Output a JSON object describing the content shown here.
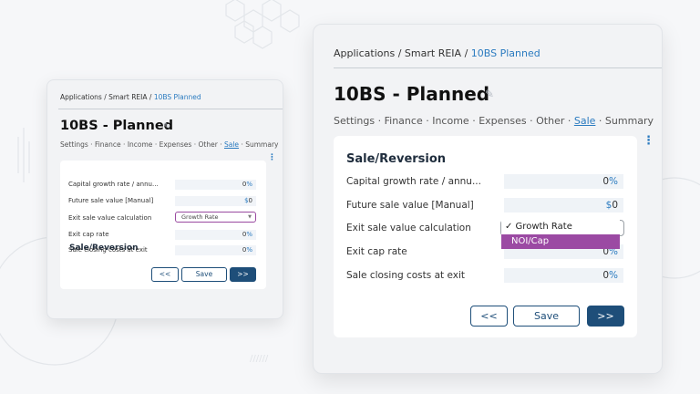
{
  "breadcrumb": {
    "part1": "Applications",
    "sep": "/",
    "part2": "Smart REIA",
    "current": "10BS Planned"
  },
  "page": {
    "title": "10BS - Planned"
  },
  "tabs": [
    "Settings",
    "Finance",
    "Income",
    "Expenses",
    "Other",
    "Sale",
    "Summary"
  ],
  "tab_separator": "·",
  "active_tab": "Sale",
  "section": {
    "title": "Sale/Reversion",
    "small_rows": [
      {
        "label": "Capital growth rate / annu...",
        "value": "0",
        "unit": "%"
      },
      {
        "label": "Future sale value [Manual]",
        "value": "0",
        "unit": "$"
      },
      {
        "label": "Exit sale value calculation",
        "select": "Growth Rate"
      },
      {
        "label": "Exit cap rate",
        "value": "0",
        "unit": "%"
      },
      {
        "label": "Sale closing costs at exit",
        "value": "0",
        "unit": "%"
      }
    ],
    "large_rows": [
      {
        "label": "Capital growth rate / annu...",
        "value": "0",
        "unit": "%"
      },
      {
        "label": "Future sale value [Manual]",
        "value": "0",
        "unit": "$"
      },
      {
        "label": "Exit sale value calculation"
      },
      {
        "label": "Exit cap rate",
        "value": "0",
        "unit": "%"
      },
      {
        "label": "Sale closing costs at exit",
        "value": "0",
        "unit": "%"
      }
    ]
  },
  "dropdown": {
    "options": [
      "✓ Growth Rate",
      "NOI/Cap"
    ],
    "highlighted": "NOI/Cap"
  },
  "buttons": {
    "prev": "<<",
    "save": "Save",
    "next": ">>"
  },
  "icons": {
    "edit": "pencil-icon",
    "more": "kebab-menu-icon",
    "dropdown": "chevron-down-icon"
  },
  "colors": {
    "accent": "#2b7bc0",
    "primary_button": "#1e4e79",
    "select_highlight": "#9b4aa3"
  }
}
